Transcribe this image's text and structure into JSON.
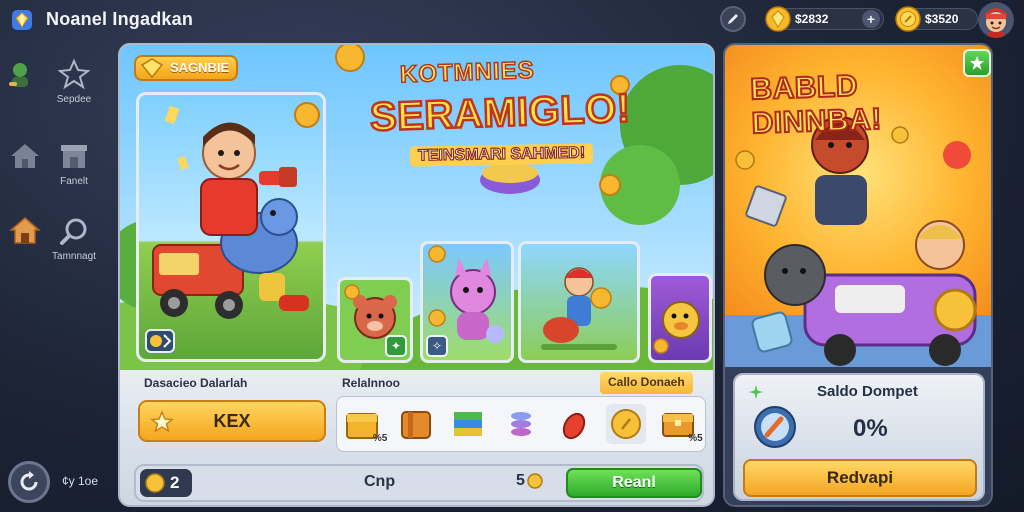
{
  "app": {
    "title": "Noanel Ingadkan"
  },
  "topbar": {
    "gems": "$2832",
    "coins": "$3520",
    "plus": "+"
  },
  "sidebar": {
    "items": [
      {
        "label": "",
        "icon": "character-icon"
      },
      {
        "label": "Sepdee",
        "icon": "star-icon"
      },
      {
        "label": "",
        "icon": "home-icon"
      },
      {
        "label": "Fanelt",
        "icon": "shop-icon"
      },
      {
        "label": "",
        "icon": "house-icon"
      },
      {
        "label": "Tamnnagt",
        "icon": "wrench-icon"
      }
    ]
  },
  "main": {
    "tag_label": "SAGNBIE",
    "title_line1": "KOTMNIES",
    "title_line2": "SERAMIGLO!",
    "title_line3": "TEINSMARI SAHMED!",
    "left_label": "Dasacieo Dalarlah",
    "kex_button": "KEX",
    "rewards_label": "Relalnnoo",
    "collect_label": "Callo Donaeh",
    "rewards": [
      {
        "icon": "chest-icon",
        "qty": "%5"
      },
      {
        "icon": "crate-icon",
        "qty": ""
      },
      {
        "icon": "rainbow-cube-icon",
        "qty": ""
      },
      {
        "icon": "spring-icon",
        "qty": ""
      },
      {
        "icon": "heart-potion-icon",
        "qty": ""
      },
      {
        "icon": "coin-icon",
        "qty": ""
      },
      {
        "icon": "treasure-chest-icon",
        "qty": "%5"
      }
    ],
    "bottom": {
      "left_value": "2",
      "middle_text": "Cnp",
      "count_value": "5",
      "reset_button": "Reanl"
    }
  },
  "promo": {
    "title": "BABLD DINNBA!"
  },
  "wallet": {
    "title": "Saldo Dompet",
    "value": "0%",
    "button": "Redvapi"
  },
  "footer": {
    "text": "¢y 1oe"
  },
  "colors": {
    "accent_yellow": "#ffd560",
    "accent_green": "#2eaa2a",
    "panel_dark": "#1d2436",
    "title_red": "#c0331e"
  }
}
